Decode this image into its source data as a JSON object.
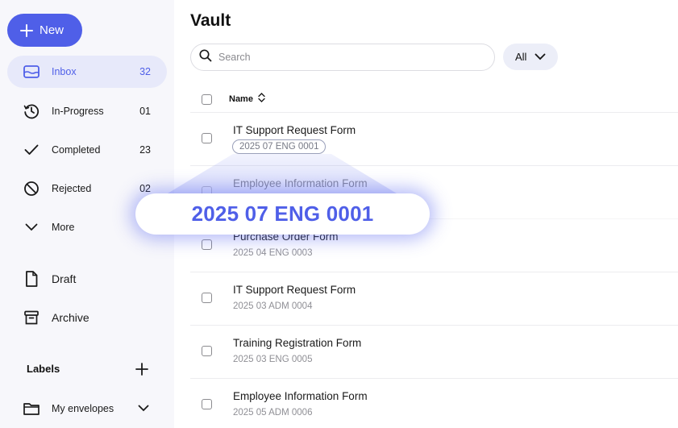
{
  "sidebar": {
    "new_label": "New",
    "items": [
      {
        "label": "Inbox",
        "count": "32"
      },
      {
        "label": "In-Progress",
        "count": "01"
      },
      {
        "label": "Completed",
        "count": "23"
      },
      {
        "label": "Rejected",
        "count": "02"
      },
      {
        "label": "More",
        "count": ""
      },
      {
        "label": "Draft",
        "count": ""
      },
      {
        "label": "Archive",
        "count": ""
      }
    ],
    "labels_title": "Labels",
    "label_folder": "My envelopes"
  },
  "main": {
    "title": "Vault",
    "search_placeholder": "Search",
    "filter_label": "All",
    "column_name": "Name",
    "rows": [
      {
        "name": "IT Support Request Form",
        "id": "2025 07 ENG 0001"
      },
      {
        "name": "Employee Information Form",
        "id": ""
      },
      {
        "name": "Purchase Order Form",
        "id": "2025 04 ENG 0003"
      },
      {
        "name": "IT Support Request Form",
        "id": "2025 03 ADM 0004"
      },
      {
        "name": "Training Registration Form",
        "id": "2025 03 ENG 0005"
      },
      {
        "name": "Employee Information Form",
        "id": "2025 05 ADM 0006"
      }
    ]
  },
  "callout": {
    "text": "2025 07 ENG 0001"
  },
  "colors": {
    "accent": "#4f5fe8",
    "active_bg": "#e7e9fa",
    "sidebar_bg": "#f7f7fb"
  }
}
